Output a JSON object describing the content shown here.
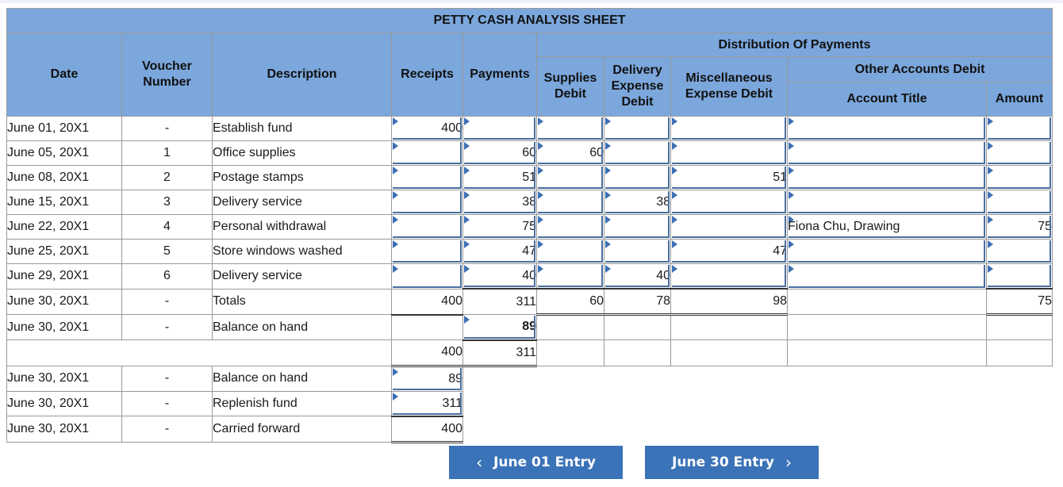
{
  "title": "PETTY CASH ANALYSIS SHEET",
  "headers": {
    "date": "Date",
    "voucher": "Voucher Number",
    "description": "Description",
    "receipts": "Receipts",
    "payments": "Payments",
    "distribution": "Distribution Of Payments",
    "supplies": "Supplies Debit",
    "delivery": "Delivery Expense Debit",
    "misc": "Miscellaneous Expense Debit",
    "other": "Other Accounts Debit",
    "account_title": "Account Title",
    "amount": "Amount"
  },
  "rows": [
    {
      "date": "June 01, 20X1",
      "voucher": "-",
      "desc": "Establish fund",
      "receipts": "400",
      "payments": "",
      "supplies": "",
      "delivery": "",
      "misc": "",
      "account": "",
      "amount": ""
    },
    {
      "date": "June 05, 20X1",
      "voucher": "1",
      "desc": "Office supplies",
      "receipts": "",
      "payments": "60",
      "supplies": "60",
      "delivery": "",
      "misc": "",
      "account": "",
      "amount": ""
    },
    {
      "date": "June 08, 20X1",
      "voucher": "2",
      "desc": "Postage stamps",
      "receipts": "",
      "payments": "51",
      "supplies": "",
      "delivery": "",
      "misc": "51",
      "account": "",
      "amount": ""
    },
    {
      "date": "June 15, 20X1",
      "voucher": "3",
      "desc": "Delivery service",
      "receipts": "",
      "payments": "38",
      "supplies": "",
      "delivery": "38",
      "misc": "",
      "account": "",
      "amount": ""
    },
    {
      "date": "June 22, 20X1",
      "voucher": "4",
      "desc": "Personal withdrawal",
      "receipts": "",
      "payments": "75",
      "supplies": "",
      "delivery": "",
      "misc": "",
      "account": "Fiona Chu, Drawing",
      "amount": "75"
    },
    {
      "date": "June 25, 20X1",
      "voucher": "5",
      "desc": "Store windows washed",
      "receipts": "",
      "payments": "47",
      "supplies": "",
      "delivery": "",
      "misc": "47",
      "account": "",
      "amount": ""
    },
    {
      "date": "June 29, 20X1",
      "voucher": "6",
      "desc": "Delivery service",
      "receipts": "",
      "payments": "40",
      "supplies": "",
      "delivery": "40",
      "misc": "",
      "account": "",
      "amount": ""
    }
  ],
  "totals": {
    "date": "June 30, 20X1",
    "voucher": "-",
    "desc": "Totals",
    "receipts": "400",
    "payments": "311",
    "supplies": "60",
    "delivery": "78",
    "misc": "98",
    "amount": "75"
  },
  "balance": {
    "date": "June 30, 20X1",
    "voucher": "-",
    "desc": "Balance on hand",
    "payments": "89"
  },
  "grand": {
    "receipts": "400",
    "payments": "311"
  },
  "after": [
    {
      "date": "June 30, 20X1",
      "voucher": "-",
      "desc": "Balance on hand",
      "receipts": "89"
    },
    {
      "date": "June 30, 20X1",
      "voucher": "-",
      "desc": "Replenish fund",
      "receipts": "311"
    },
    {
      "date": "June 30, 20X1",
      "voucher": "-",
      "desc": "Carried forward",
      "receipts": "400"
    }
  ],
  "nav": {
    "prev": "June 01 Entry",
    "next": "June 30 Entry",
    "prev_icon": "chevron-left-icon",
    "next_icon": "chevron-right-icon"
  }
}
